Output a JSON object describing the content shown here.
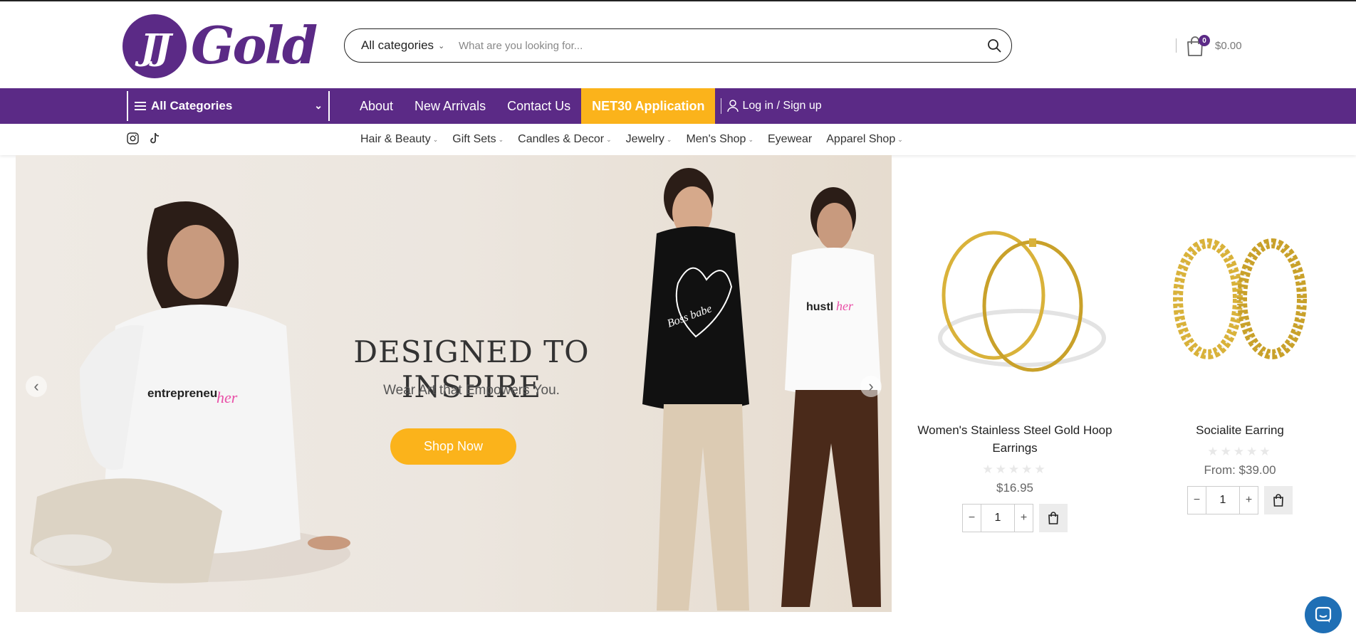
{
  "header": {
    "logo_initials": "JJ",
    "logo_word": "Gold",
    "search": {
      "category": "All categories",
      "placeholder": "What are you looking for..."
    },
    "cart": {
      "count": "0",
      "total": "$0.00"
    }
  },
  "nav": {
    "all_categories": "All Categories",
    "items": [
      "About",
      "New Arrivals",
      "Contact Us",
      "NET30 Application"
    ],
    "login": "Log in / Sign up"
  },
  "subnav": {
    "items": [
      "Hair & Beauty",
      "Gift Sets",
      "Candles & Decor",
      "Jewelry",
      "Men's Shop",
      "Eyewear",
      "Apparel Shop"
    ]
  },
  "hero": {
    "title": "DESIGNED TO INSPIRE",
    "subtitle": "Wear Art that Empowers You.",
    "button": "Shop Now",
    "hoodie_text_1": "entrepreneu",
    "hoodie_text_2": "her",
    "sweatshirt_text": "Boss babe",
    "tee_text_1": "hustl",
    "tee_text_2": "her"
  },
  "products": [
    {
      "title_line1": "Women's Stainless Steel Gold Hoop",
      "title_line2": "Earrings",
      "rating": 0,
      "price": "$16.95",
      "qty": "1"
    },
    {
      "title_line1": "Socialite Earring",
      "title_line2": "",
      "rating": 0,
      "price": "From: $39.00",
      "qty": "1"
    }
  ],
  "colors": {
    "brand": "#5b2a86",
    "accent": "#fbb31b",
    "chat": "#1f6fb5"
  }
}
